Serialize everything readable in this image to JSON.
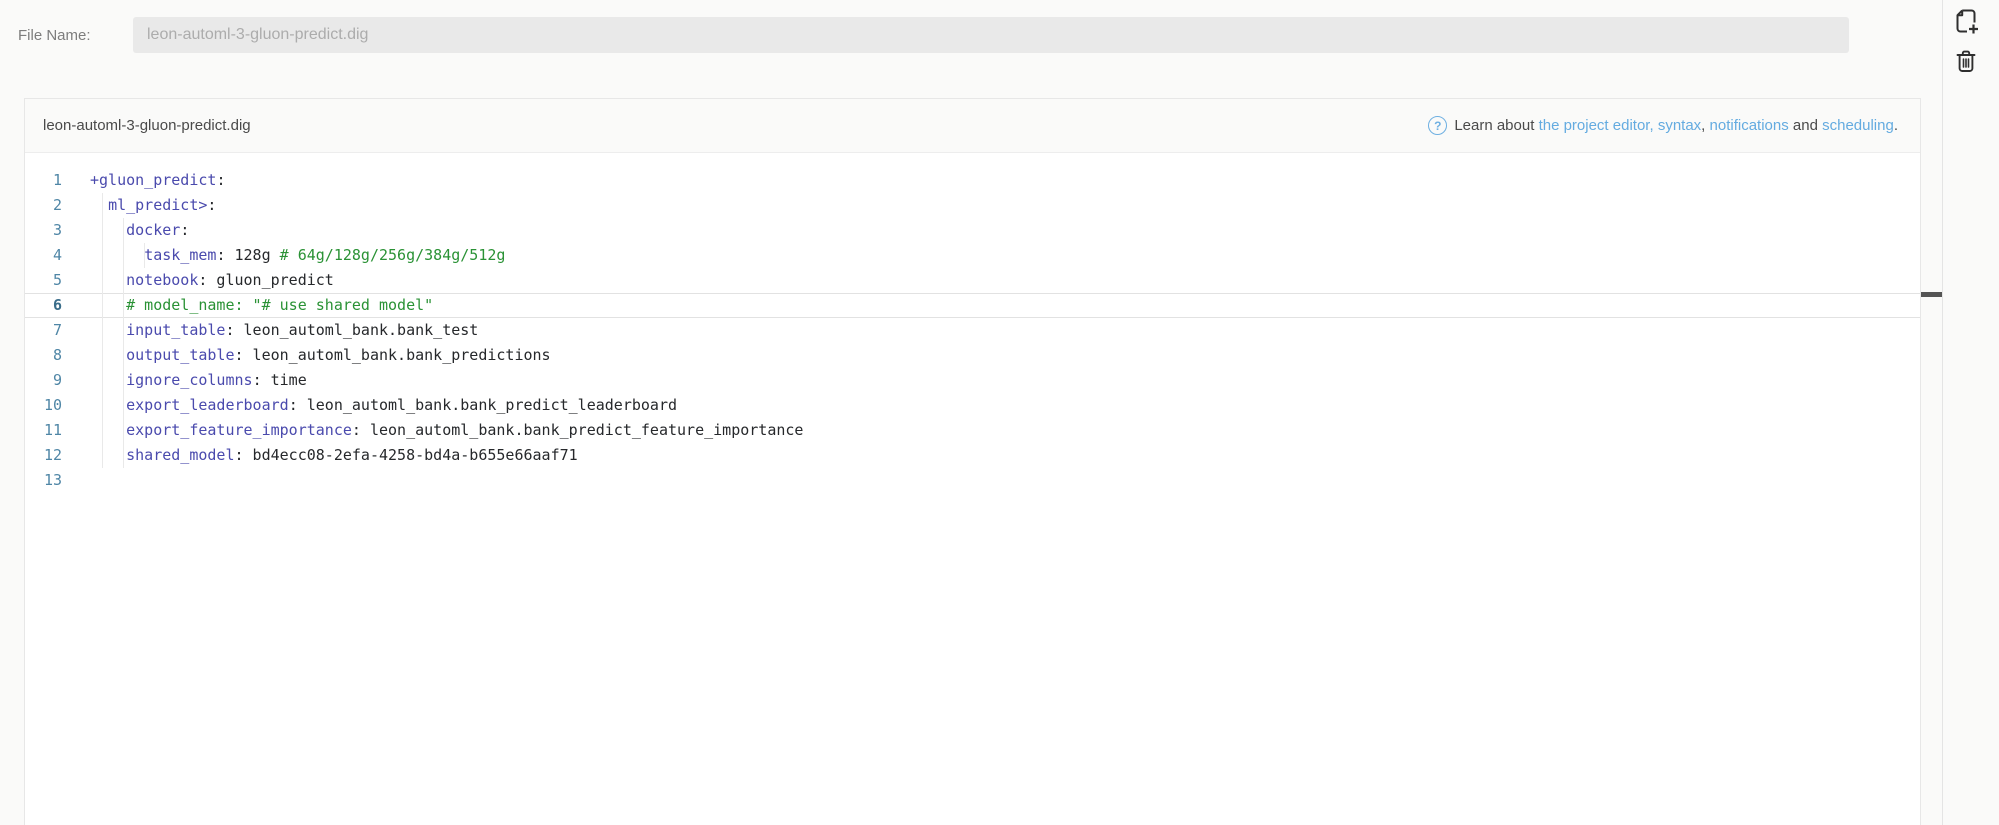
{
  "topbar": {
    "file_name_label": "File Name:",
    "filename_value": "leon-automl-3-gluon-predict.dig"
  },
  "rail": {
    "icons": [
      {
        "name": "new-file-icon"
      },
      {
        "name": "trash-icon"
      }
    ]
  },
  "editor_panel": {
    "title": "leon-automl-3-gluon-predict.dig",
    "help": {
      "icon": "help-circle-icon",
      "segments": [
        {
          "text": "Learn about ",
          "link": false
        },
        {
          "text": "the project editor,",
          "link": true
        },
        {
          "text": " ",
          "link": false
        },
        {
          "text": "syntax",
          "link": true
        },
        {
          "text": ", ",
          "link": false
        },
        {
          "text": "notifications",
          "link": true
        },
        {
          "text": " and ",
          "link": false
        },
        {
          "text": "scheduling",
          "link": true
        },
        {
          "text": ".",
          "link": false
        }
      ]
    },
    "editor": {
      "active_line": 6,
      "lines": [
        {
          "num": 1,
          "indent": 0,
          "guides": 0,
          "tokens": [
            {
              "t": "key",
              "s": "+gluon_predict"
            },
            {
              "t": "plain",
              "s": ":"
            }
          ]
        },
        {
          "num": 2,
          "indent": 2,
          "guides": 1,
          "tokens": [
            {
              "t": "key",
              "s": "ml_predict>"
            },
            {
              "t": "plain",
              "s": ":"
            }
          ]
        },
        {
          "num": 3,
          "indent": 4,
          "guides": 2,
          "tokens": [
            {
              "t": "key",
              "s": "docker"
            },
            {
              "t": "plain",
              "s": ":"
            }
          ]
        },
        {
          "num": 4,
          "indent": 6,
          "guides": 3,
          "tokens": [
            {
              "t": "key",
              "s": "task_mem"
            },
            {
              "t": "plain",
              "s": ": 128g "
            },
            {
              "t": "comment",
              "s": "# 64g/128g/256g/384g/512g"
            }
          ]
        },
        {
          "num": 5,
          "indent": 4,
          "guides": 2,
          "tokens": [
            {
              "t": "key",
              "s": "notebook"
            },
            {
              "t": "plain",
              "s": ": gluon_predict"
            }
          ]
        },
        {
          "num": 6,
          "indent": 4,
          "guides": 2,
          "tokens": [
            {
              "t": "comment",
              "s": "# model_name: \"# use shared model\""
            }
          ]
        },
        {
          "num": 7,
          "indent": 4,
          "guides": 2,
          "tokens": [
            {
              "t": "key",
              "s": "input_table"
            },
            {
              "t": "plain",
              "s": ": leon_automl_bank.bank_test"
            }
          ]
        },
        {
          "num": 8,
          "indent": 4,
          "guides": 2,
          "tokens": [
            {
              "t": "key",
              "s": "output_table"
            },
            {
              "t": "plain",
              "s": ": leon_automl_bank.bank_predictions"
            }
          ]
        },
        {
          "num": 9,
          "indent": 4,
          "guides": 2,
          "tokens": [
            {
              "t": "key",
              "s": "ignore_columns"
            },
            {
              "t": "plain",
              "s": ": time"
            }
          ]
        },
        {
          "num": 10,
          "indent": 4,
          "guides": 2,
          "tokens": [
            {
              "t": "key",
              "s": "export_leaderboard"
            },
            {
              "t": "plain",
              "s": ": leon_automl_bank.bank_predict_leaderboard"
            }
          ]
        },
        {
          "num": 11,
          "indent": 4,
          "guides": 2,
          "tokens": [
            {
              "t": "key",
              "s": "export_feature_importance"
            },
            {
              "t": "plain",
              "s": ": leon_automl_bank.bank_predict_feature_importance"
            }
          ]
        },
        {
          "num": 12,
          "indent": 4,
          "guides": 2,
          "tokens": [
            {
              "t": "key",
              "s": "shared_model"
            },
            {
              "t": "plain",
              "s": ": bd4ecc08-2efa-4258-bd4a-b655e66aaf71"
            }
          ]
        },
        {
          "num": 13,
          "indent": 0,
          "guides": 0,
          "tokens": []
        }
      ]
    }
  },
  "colors": {
    "link_blue": "#64abe0",
    "syntax_key": "#4a4aad",
    "syntax_comment": "#2a9235",
    "line_number": "#4f86a6",
    "input_bg": "#e9e9e9",
    "panel_bg": "#ffffff",
    "page_bg": "#fafaf9"
  }
}
